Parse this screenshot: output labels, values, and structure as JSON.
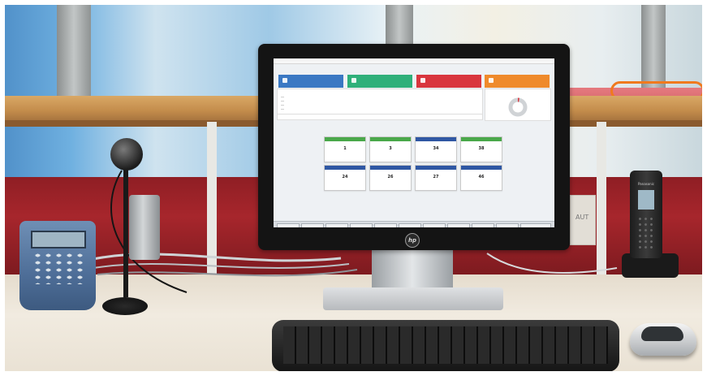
{
  "screen": {
    "tiles": [
      {
        "value": "1",
        "color": "#49a84a"
      },
      {
        "value": "3",
        "color": "#49a84a"
      },
      {
        "value": "34",
        "color": "#2f57a3"
      },
      {
        "value": "38",
        "color": "#49a84a"
      },
      {
        "value": "24",
        "color": "#2f57a3"
      },
      {
        "value": "26",
        "color": "#2f57a3"
      },
      {
        "value": "27",
        "color": "#2f57a3"
      },
      {
        "value": "46",
        "color": "#2f57a3"
      }
    ],
    "cards": [
      {
        "name": "card-1",
        "color": "#3a78c3",
        "icon": "lock-icon"
      },
      {
        "name": "card-2",
        "color": "#2fb07a",
        "icon": "chart-icon"
      },
      {
        "name": "card-3",
        "color": "#d9363e",
        "icon": "alert-icon"
      },
      {
        "name": "card-4",
        "color": "#ef8a2b",
        "icon": "ban-icon"
      }
    ],
    "donut_colors": {
      "track": "#d0d3d6",
      "accent": "#d9363e"
    }
  },
  "monitor": {
    "brand": "hp"
  },
  "phone": {
    "brand": "Panasonic"
  },
  "socket": {
    "label": "AUT"
  }
}
